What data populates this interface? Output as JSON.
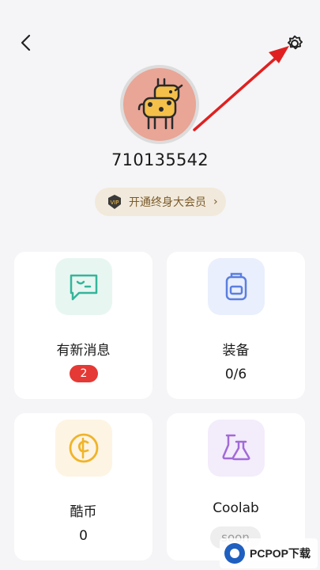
{
  "header": {
    "back_icon": "back-arrow-icon",
    "settings_icon": "gear-icon"
  },
  "profile": {
    "username": "710135542",
    "avatar_icon": "giraffe-avatar"
  },
  "vip": {
    "badge_text": "VIP",
    "label": "开通终身大会员",
    "chevron": "›"
  },
  "cards": [
    {
      "id": "messages",
      "title": "有新消息",
      "badge": "2",
      "icon": "message-icon",
      "icon_bg": "#e8f6f1",
      "icon_color": "#34b59a"
    },
    {
      "id": "equipment",
      "title": "装备",
      "value": "0/6",
      "icon": "backpack-icon",
      "icon_bg": "#e9effc",
      "icon_color": "#5b7fe0"
    },
    {
      "id": "coins",
      "title": "酷币",
      "value": "0",
      "icon": "coin-icon",
      "icon_bg": "#fdf4e3",
      "icon_color": "#f0b429"
    },
    {
      "id": "coolab",
      "title": "Coolab",
      "status": "soon",
      "icon": "flask-icon",
      "icon_bg": "#f3ecfb",
      "icon_color": "#a26ad8"
    }
  ],
  "watermark": {
    "text": "PCPOP下载"
  },
  "colors": {
    "accent_red": "#e53935",
    "vip_bg": "#f1e9db",
    "page_bg": "#f5f5f7"
  }
}
